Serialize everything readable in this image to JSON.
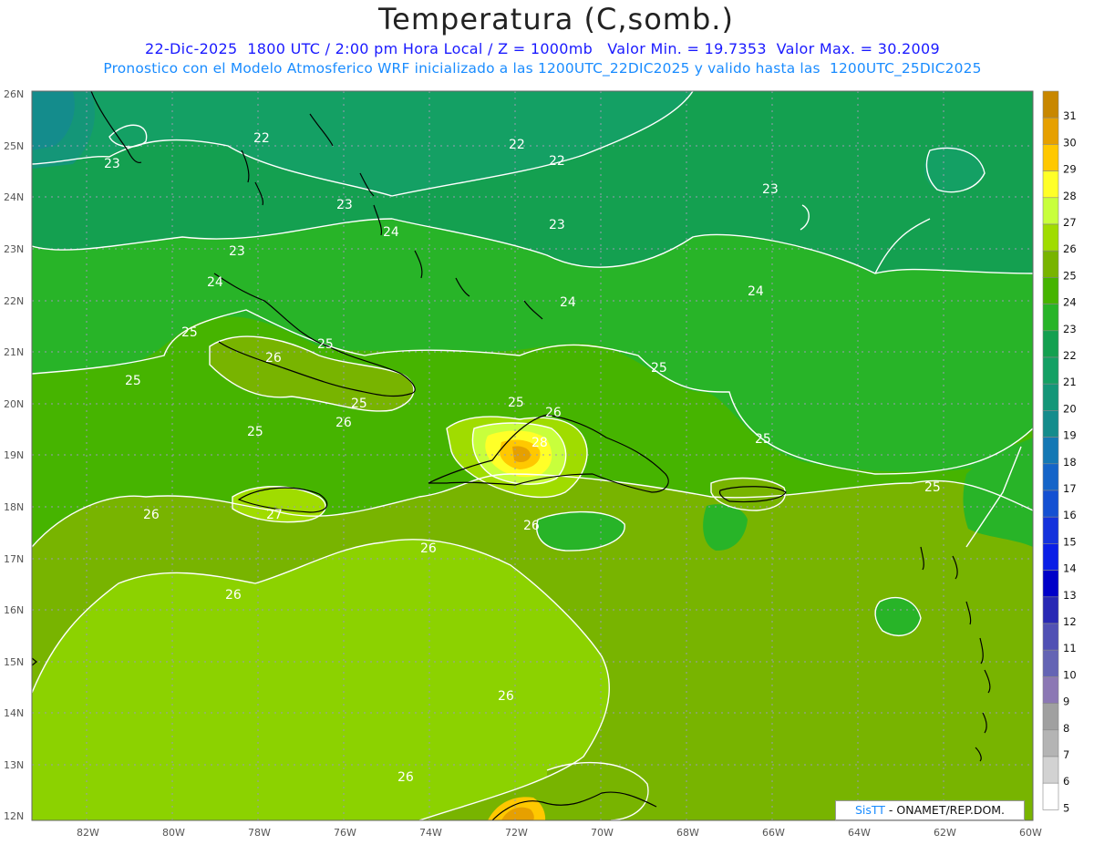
{
  "title": "Temperatura (C,somb.)",
  "subtitle": "22-Dic-2025  1800 UTC / 2:00 pm Hora Local / Z = 1000mb   Valor Min. = 19.7353  Valor Max. = 30.2009",
  "subtitle2": "Pronostico con el Modelo Atmosferico WRF inicializado a las 1200UTC_22DIC2025 y valido hasta las  1200UTC_25DIC2025",
  "credit": {
    "brand": "SisTT",
    "rest": " - ONAMET/REP.DOM."
  },
  "lat_labels": [
    "26N",
    "25N",
    "24N",
    "23N",
    "22N",
    "21N",
    "20N",
    "19N",
    "18N",
    "17N",
    "16N",
    "15N",
    "14N",
    "13N",
    "12N"
  ],
  "lon_labels": [
    "82W",
    "80W",
    "78W",
    "76W",
    "74W",
    "72W",
    "70W",
    "68W",
    "66W",
    "64W",
    "62W",
    "60W"
  ],
  "colorbar": {
    "labels": [
      "31",
      "30",
      "29",
      "28",
      "27",
      "26",
      "25",
      "24",
      "23",
      "22",
      "21",
      "20",
      "19",
      "18",
      "17",
      "16",
      "15",
      "14",
      "13",
      "12",
      "11",
      "10",
      "9",
      "8",
      "7",
      "6",
      "5"
    ],
    "colors": [
      "#c88700",
      "#e6a000",
      "#ffc800",
      "#ffff28",
      "#c8ff3c",
      "#a0dc00",
      "#78b400",
      "#46b400",
      "#28b428",
      "#14a050",
      "#14a064",
      "#149678",
      "#148c8c",
      "#1478b4",
      "#1464c8",
      "#1450d2",
      "#1432dc",
      "#0a1ee6",
      "#0000c8",
      "#2828b4",
      "#5050b4",
      "#6464b4",
      "#8c78b4",
      "#a0a0a0",
      "#b4b4b4",
      "#d2d2d2",
      "#ffffff"
    ]
  },
  "isotherm_labels": [
    "22",
    "22",
    "22",
    "23",
    "23",
    "23",
    "23",
    "23",
    "24",
    "24",
    "24",
    "24",
    "25",
    "25",
    "25",
    "25",
    "25",
    "25",
    "25",
    "25",
    "25",
    "26",
    "26",
    "26",
    "26",
    "26",
    "26",
    "26",
    "26",
    "27",
    "28",
    "26"
  ],
  "colors": {
    "ocean_north": "#14a050",
    "ocean_mid": "#28b428",
    "ocean_south": "#78b400",
    "far_south": "#8cd200",
    "hot": "#ffc800",
    "contour": "#ffffff",
    "coast": "#000000",
    "grid": "#9a9ab4"
  }
}
